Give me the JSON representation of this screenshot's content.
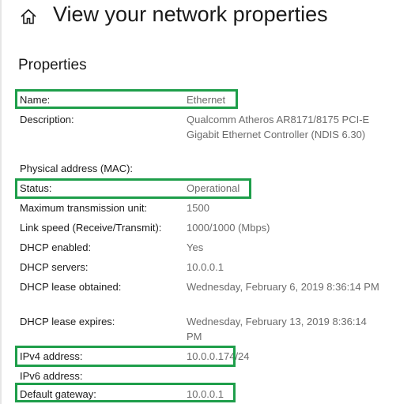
{
  "header": {
    "home_icon": "home-icon",
    "title": "View your network properties"
  },
  "section_title": "Properties",
  "properties": [
    {
      "label": "Name:",
      "value": "Ethernet"
    },
    {
      "label": "Description:",
      "value": "Qualcomm Atheros AR8171/8175 PCI-E Gigabit Ethernet Controller (NDIS 6.30)"
    },
    {
      "label": "Physical address (MAC):",
      "value": ""
    },
    {
      "label": "Status:",
      "value": "Operational"
    },
    {
      "label": "Maximum transmission unit:",
      "value": "1500"
    },
    {
      "label": "Link speed (Receive/Transmit):",
      "value": "1000/1000 (Mbps)"
    },
    {
      "label": "DHCP enabled:",
      "value": "Yes"
    },
    {
      "label": "DHCP servers:",
      "value": "10.0.0.1"
    },
    {
      "label": "DHCP lease obtained:",
      "value": "Wednesday, February 6, 2019 8:36:14 PM"
    },
    {
      "label": "DHCP lease expires:",
      "value": "Wednesday, February 13, 2019 8:36:14 PM"
    },
    {
      "label": "IPv4 address:",
      "value": "10.0.0.174/24"
    },
    {
      "label": "IPv6 address:",
      "value": ""
    },
    {
      "label": "Default gateway:",
      "value": "10.0.0.1"
    }
  ],
  "highlight_color": "#1e9e4a"
}
